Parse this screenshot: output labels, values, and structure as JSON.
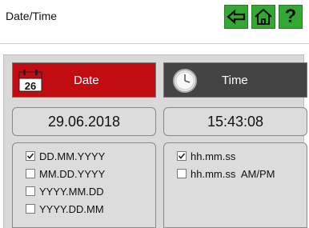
{
  "header": {
    "title": "Date/Time",
    "buttons": {
      "back": "back-arrow-icon",
      "home": "home-icon",
      "help_label": "?"
    },
    "accent": "#33a833"
  },
  "tabs": {
    "date": {
      "label": "Date",
      "icon": "calendar-icon",
      "calendar_day": "26",
      "color": "#c10d12"
    },
    "time": {
      "label": "Time",
      "icon": "clock-icon",
      "color": "#444444"
    }
  },
  "values": {
    "date": "29.06.2018",
    "time": "15:43:08"
  },
  "date_formats": [
    {
      "label": "DD.MM.YYYY",
      "checked": true
    },
    {
      "label": "MM.DD.YYYY",
      "checked": false
    },
    {
      "label": "YYYY.MM.DD",
      "checked": false
    },
    {
      "label": "YYYY.DD.MM",
      "checked": false
    }
  ],
  "time_formats": [
    {
      "label": "hh.mm.ss",
      "checked": true
    },
    {
      "label": "hh.mm.ss  AM/PM",
      "checked": false
    }
  ]
}
